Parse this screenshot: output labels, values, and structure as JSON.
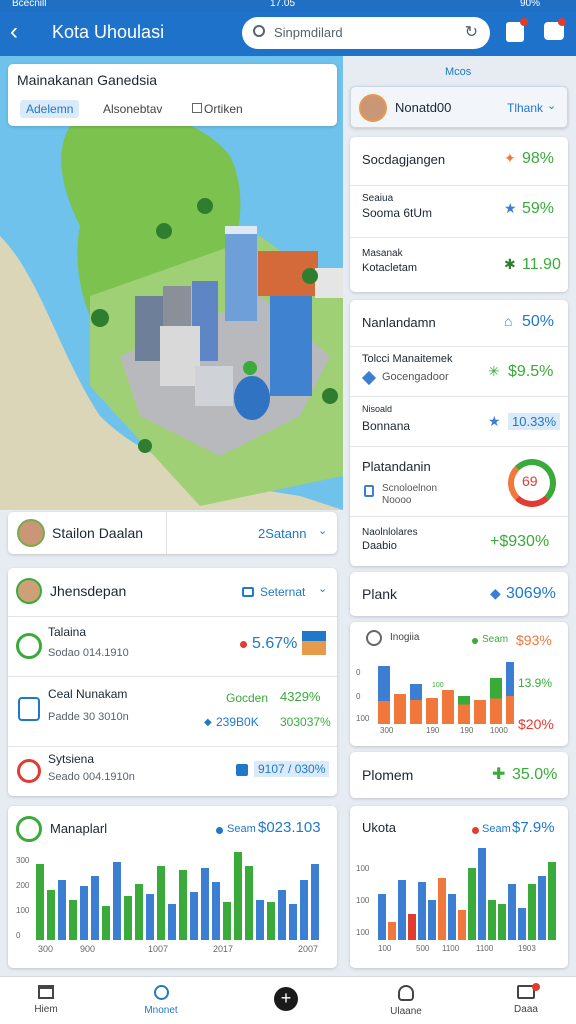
{
  "status": {
    "carrier": "Bcecnill",
    "time": "17.05",
    "battery": "90%"
  },
  "header": {
    "title": "Kota Uhoulasi",
    "search_text": "Sinpmdilard"
  },
  "map_card": {
    "title": "Mainakanan Ganedsia",
    "tabs": [
      "Adelemn",
      "Alsonebtav",
      "Ortiken"
    ]
  },
  "station": {
    "name": "Stailon Daalan",
    "link": "2Satann"
  },
  "info_card": {
    "title": "Jhensdepan",
    "dropdown": "Seternat",
    "items": [
      {
        "title": "Talaina",
        "sub": "Sodao 014.1910",
        "value": "5.67%",
        "color": "#1f78c8"
      },
      {
        "title": "Ceal Nunakam",
        "sub": "Padde 30 3010n",
        "tag": "Gocden",
        "tag_value": "4329%",
        "v2": "239B0K",
        "v3": "303037%"
      },
      {
        "title": "Sytsiena",
        "sub": "Seado 004.1910n",
        "badge": "9107 / 030%"
      }
    ]
  },
  "bar1": {
    "title": "Manaplarl",
    "legend": "Seam",
    "value": "$023.103",
    "y_ticks": [
      "300",
      "200",
      "100",
      "0"
    ],
    "x_ticks": [
      "300",
      "900",
      "1007",
      "2017",
      "2007"
    ]
  },
  "right": {
    "label": "Mcos",
    "user": {
      "name": "Nonatd00",
      "link": "Tlhank"
    },
    "group1": [
      {
        "label": "Socdagjangen",
        "value": "98%"
      },
      {
        "label": "Seaiua",
        "label2": "Sooma 6tUm",
        "value": "59%"
      },
      {
        "label": "Masanak",
        "label2": "Kotacletam",
        "value": "11.90"
      }
    ],
    "group2": [
      {
        "label": "Nanlandamn",
        "value": "50%"
      },
      {
        "label": "Tolcci Manaitemek",
        "label2": "Gocengadoor",
        "value": "$9.5%"
      },
      {
        "label": "Nisoald",
        "label2": "Bonnana",
        "value": "10.33%"
      },
      {
        "label": "Platandanin",
        "label2": "Scnoloelnon",
        "label3": "Noooo",
        "gauge": "69"
      },
      {
        "label": "Naolnlolares",
        "label2": "Daabio",
        "value": "+$930%"
      }
    ],
    "group3": {
      "title": "Plank",
      "value": "3069%"
    },
    "mini_chart": {
      "label": "Inogiia",
      "legend": "Seam",
      "value1": "$93%",
      "value2": "13.9%",
      "value3": "$20%",
      "y_ticks": [
        "0",
        "0",
        "100"
      ],
      "x_ticks": [
        "300",
        "190",
        "190",
        "1000"
      ],
      "top_label": "100"
    },
    "plomem": {
      "title": "Plomem",
      "value": "35.0%"
    },
    "bar2": {
      "title": "Ukota",
      "legend": "Seam",
      "value": "$7.9%",
      "y_ticks": [
        "100",
        "100",
        "100"
      ],
      "x_ticks": [
        "100",
        "500",
        "1100",
        "1100",
        "1903"
      ]
    }
  },
  "nav": {
    "items": [
      "Hiem",
      "Mnonet",
      "",
      "Ulaane",
      "Daaa"
    ]
  },
  "colors": {
    "primary": "#1f78c8",
    "green": "#3aaa3a",
    "orange": "#f0783c",
    "red": "#e03c32",
    "blue": "#3c7ed2"
  }
}
